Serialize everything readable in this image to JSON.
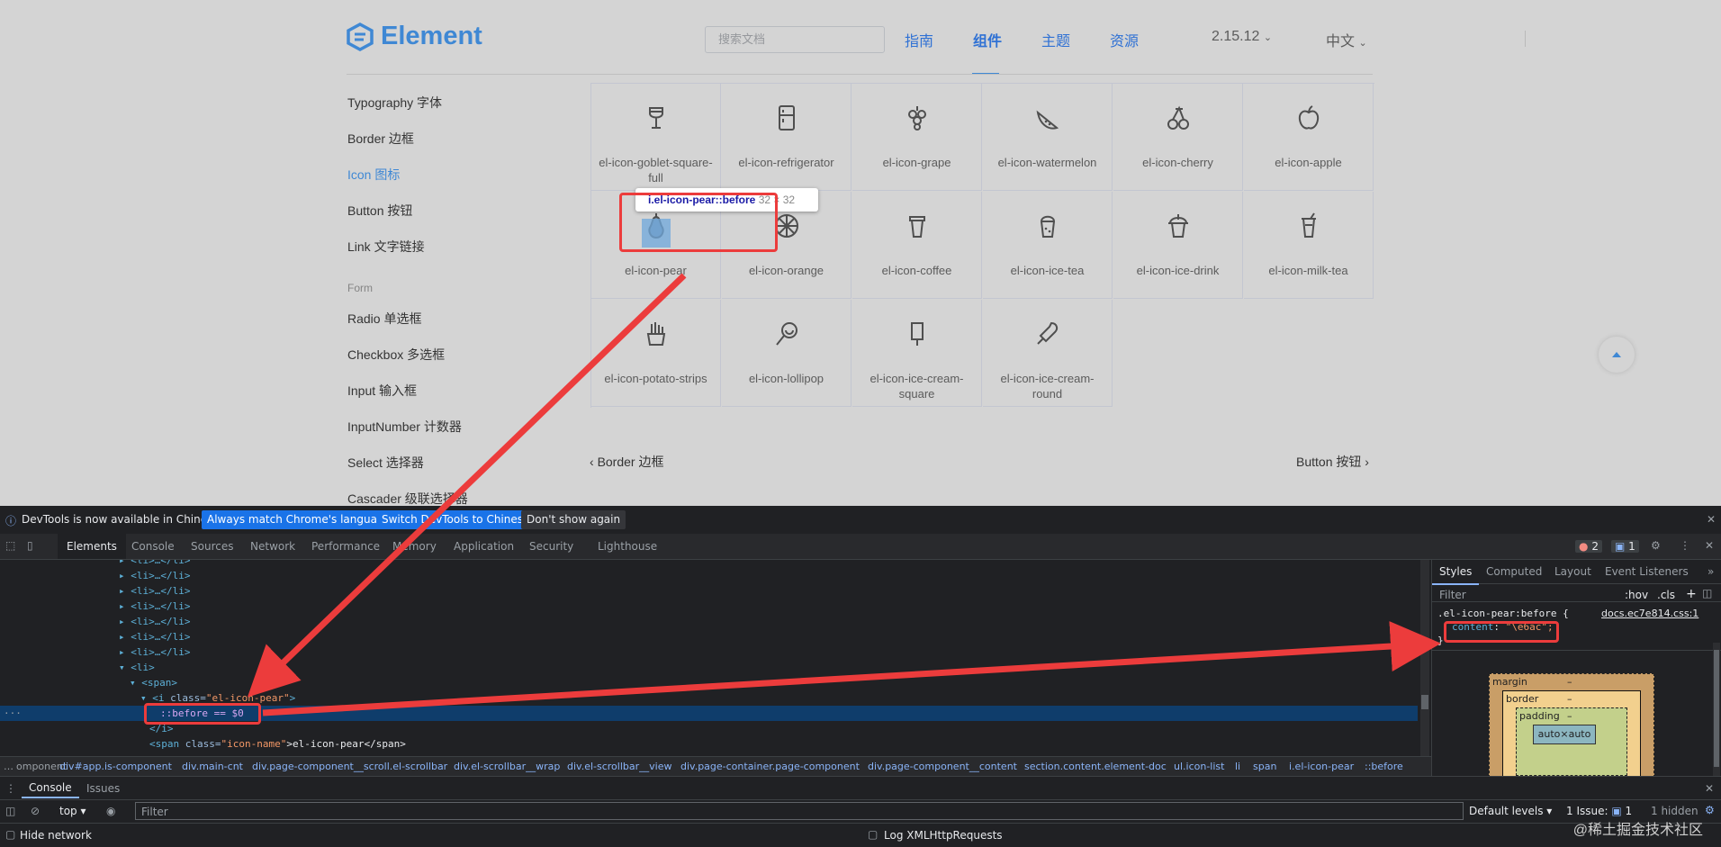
{
  "header": {
    "brand": "Element",
    "search_placeholder": "搜索文档",
    "nav": [
      "指南",
      "组件",
      "主题",
      "资源"
    ],
    "version": "2.15.12",
    "language": "中文"
  },
  "sidebar": {
    "items": [
      "Typography 字体",
      "Border 边框",
      "Icon 图标",
      "Button 按钮",
      "Link 文字链接"
    ],
    "group": "Form",
    "form_items": [
      "Radio 单选框",
      "Checkbox 多选框",
      "Input 输入框",
      "InputNumber 计数器",
      "Select 选择器",
      "Cascader 级联选择器"
    ]
  },
  "icons": {
    "row1": [
      "el-icon-goblet-square-full",
      "el-icon-refrigerator",
      "el-icon-grape",
      "el-icon-watermelon",
      "el-icon-cherry",
      "el-icon-apple"
    ],
    "row2": [
      "el-icon-pear",
      "el-icon-orange",
      "el-icon-coffee",
      "el-icon-ice-tea",
      "el-icon-ice-drink",
      "el-icon-milk-tea"
    ],
    "row3": [
      "el-icon-potato-strips",
      "el-icon-lollipop",
      "el-icon-ice-cream-square",
      "el-icon-ice-cream-round"
    ]
  },
  "tooltip": {
    "selector": "i.el-icon-pear::before",
    "size": "32 × 32"
  },
  "pager": {
    "prev": "Border 边框",
    "next": "Button 按钮"
  },
  "devtools": {
    "infobar": {
      "message": "DevTools is now available in Chinese!",
      "btn_match": "Always match Chrome's language",
      "btn_switch": "Switch DevTools to Chinese",
      "btn_dismiss": "Don't show again"
    },
    "tabs": [
      "Elements",
      "Console",
      "Sources",
      "Network",
      "Performance",
      "Memory",
      "Application",
      "Security",
      "Lighthouse"
    ],
    "badges": {
      "errors": "2",
      "issues": "1"
    },
    "dom_lines": {
      "li": "<li>…</li>",
      "li_open": "<li>",
      "span_open": "<span>",
      "i_tag": "<i ",
      "i_attr": "class=",
      "i_val": "\"el-icon-pear\"",
      "i_close": ">",
      "before": "::before == $0",
      "i_end": "</i>",
      "span2_open": "<span ",
      "span2_attr": "class=",
      "span2_val": "\"icon-name\"",
      "span2_text": ">el-icon-pear</span>"
    },
    "breadcrumbs": [
      "…",
      "omponent",
      "div#app.is-component",
      "div.main-cnt",
      "div.page-component__scroll.el-scrollbar",
      "div.el-scrollbar__wrap",
      "div.el-scrollbar__view",
      "div.page-container.page-component",
      "div.page-component__content",
      "section.content.element-doc",
      "ul.icon-list",
      "li",
      "span",
      "i.el-icon-pear",
      "::before"
    ],
    "styles": {
      "tabs": [
        "Styles",
        "Computed",
        "Layout",
        "Event Listeners",
        "»"
      ],
      "filter": "Filter",
      "hov": ":hov",
      "cls": ".cls",
      "rule_selector": ".el-icon-pear:before {",
      "source": "docs.ec7e814.css:1",
      "prop": "content",
      "prop_value": "\"\\e6ac\";",
      "close": "}",
      "box_margin": "margin",
      "box_border": "border",
      "box_padding": "padding",
      "box_content": "auto×auto",
      "dash": "–"
    },
    "console": {
      "tabs": [
        "Console",
        "Issues"
      ],
      "context": "top",
      "filter_placeholder": "Filter",
      "levels": "Default levels",
      "issues": "1 Issue:",
      "issues_count": "1",
      "hidden": "1 hidden",
      "hide_network": "Hide network",
      "log_xhr": "Log XMLHttpRequests"
    }
  },
  "watermark": "@稀土掘金技术社区"
}
